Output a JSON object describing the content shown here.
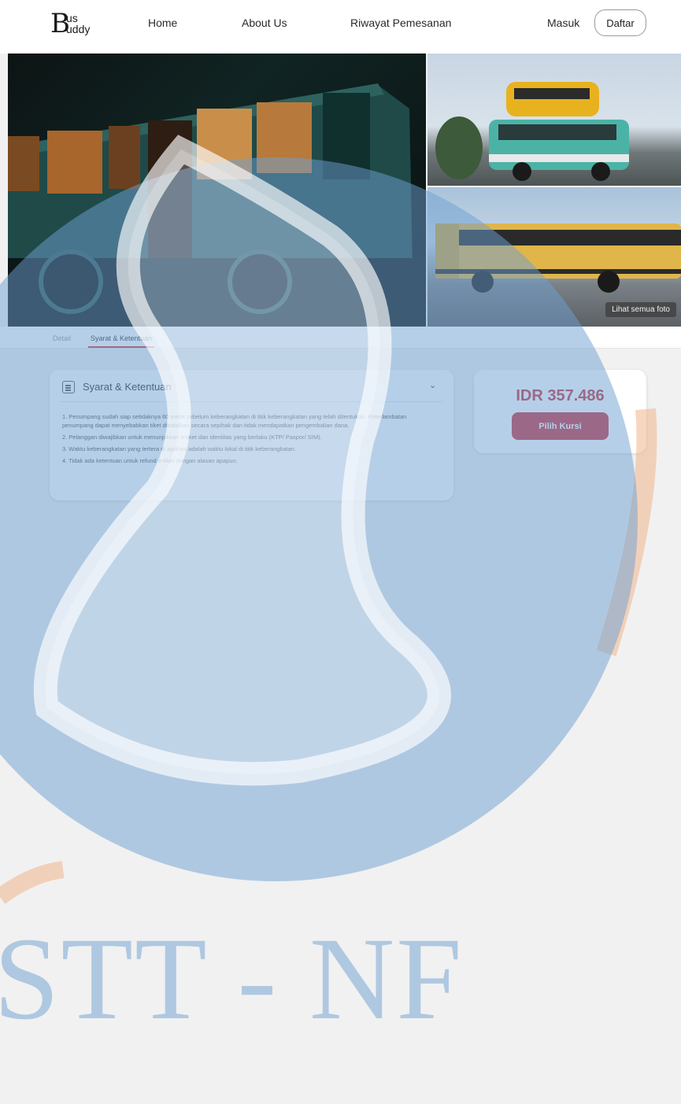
{
  "brand": {
    "logo_big": "B",
    "logo_top": "us",
    "logo_bottom": "uddy"
  },
  "nav": {
    "home": "Home",
    "about": "About Us",
    "history": "Riwayat Pemesanan",
    "login": "Masuk",
    "register": "Daftar"
  },
  "gallery": {
    "see_all": "Lihat semua foto"
  },
  "tabs": {
    "detail": "Detail",
    "terms": "Syarat & Ketentuan"
  },
  "terms": {
    "title": "Syarat & Ketentuan",
    "items": [
      {
        "num": "1.",
        "text": "Penumpang sudah siap setidaknya 60 menit sebelum keberangkatan di titik keberangkatan yang telah ditentukan. Keterlambatan penumpang dapat menyebabkan tiket dibatalkan secara sepihak dan tidak mendapatkan pengembalian dana."
      },
      {
        "num": "2.",
        "text": "Pelanggan diwajibkan untuk menunjukkan e-tiket dan identitas yang berlaku (KTP/ Paspor/ SIM)."
      },
      {
        "num": "3.",
        "text": "Waktu keberangkatan yang tertera di aplikasi adalah waktu lokal di titik keberangkatan."
      },
      {
        "num": "4.",
        "text": "Tidak ada ketentuan untuk refund e-tiket dengan alasan apapun."
      }
    ]
  },
  "booking": {
    "price": "IDR 357.486",
    "button": "Pilih Kursi"
  },
  "watermark": {
    "text": "STT - NF"
  },
  "colors": {
    "accent": "#c9303e",
    "watermark_blue": "#6ea0d2",
    "watermark_orange": "#f0b48c"
  }
}
